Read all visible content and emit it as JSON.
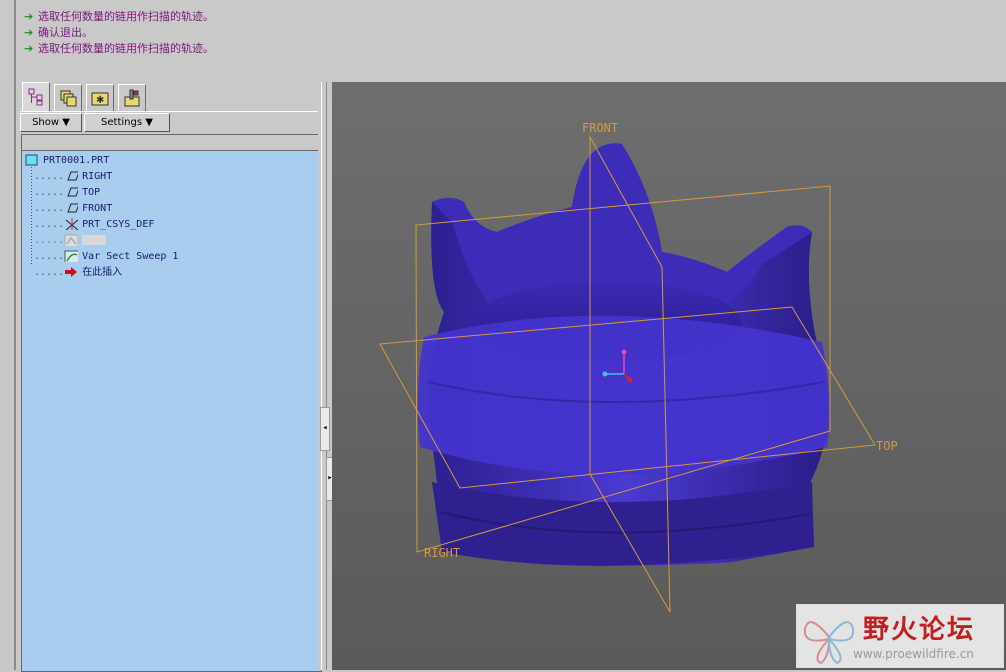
{
  "messages": [
    "选取任何数量的链用作扫描的轨迹。",
    "确认退出。",
    "选取任何数量的链用作扫描的轨迹。"
  ],
  "tabs": [
    "model-tree",
    "layers",
    "favorites",
    "tools"
  ],
  "toolbar": {
    "show_label": "Show ▼",
    "settings_label": "Settings ▼"
  },
  "tree": {
    "root": "PRT0001.PRT",
    "items": [
      {
        "label": "RIGHT",
        "icon": "datum-plane-icon"
      },
      {
        "label": "TOP",
        "icon": "datum-plane-icon"
      },
      {
        "label": "FRONT",
        "icon": "datum-plane-icon"
      },
      {
        "label": "PRT_CSYS_DEF",
        "icon": "csys-icon"
      },
      {
        "label": "",
        "icon": "suppressed-feature-icon"
      },
      {
        "label": "Var Sect Sweep 1",
        "icon": "sweep-icon"
      },
      {
        "label": "在此插入",
        "icon": "insert-here-arrow-icon"
      }
    ]
  },
  "viewport": {
    "plane_labels": {
      "front": "FRONT",
      "top": "TOP",
      "right": "RIGHT"
    },
    "colors": {
      "model": "#3f2fb4",
      "datum": "#d49a3a",
      "background": "#666666"
    }
  },
  "logo": {
    "title": "野火论坛",
    "url": "www.proewildfire.cn"
  }
}
